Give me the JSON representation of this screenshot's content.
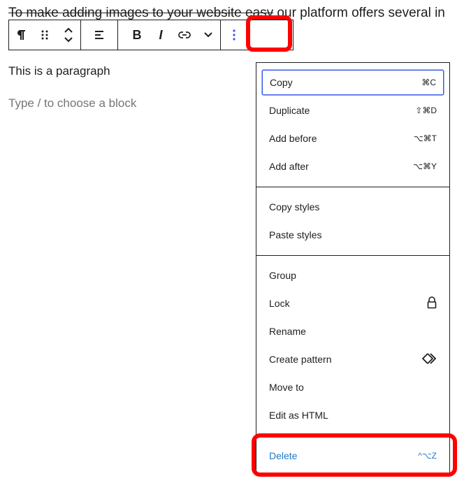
{
  "background_text": {
    "struck": "To make adding images to your website easy",
    "rest": " our platform offers several in"
  },
  "toolbar": {
    "paragraph_icon": "paragraph-icon",
    "drag_icon": "drag-handle-icon",
    "move_icon": "move-up-down-icon",
    "align_icon": "align-icon",
    "bold_label": "B",
    "italic_label": "I",
    "link_icon": "link-icon",
    "more_rich_icon": "chevron-down-icon",
    "options_icon": "vertical-ellipsis-icon"
  },
  "editor": {
    "paragraph_text": "This is a paragraph",
    "placeholder_text": "Type / to choose a block"
  },
  "menu": {
    "group1": [
      {
        "label": "Copy",
        "shortcut": "⌘C"
      },
      {
        "label": "Duplicate",
        "shortcut": "⇧⌘D"
      },
      {
        "label": "Add before",
        "shortcut": "⌥⌘T"
      },
      {
        "label": "Add after",
        "shortcut": "⌥⌘Y"
      }
    ],
    "group2": [
      {
        "label": "Copy styles"
      },
      {
        "label": "Paste styles"
      }
    ],
    "group3": [
      {
        "label": "Group"
      },
      {
        "label": "Lock",
        "icon": "lock-icon"
      },
      {
        "label": "Rename"
      },
      {
        "label": "Create pattern",
        "icon": "pattern-icon"
      },
      {
        "label": "Move to"
      },
      {
        "label": "Edit as HTML"
      }
    ],
    "delete": {
      "label": "Delete",
      "shortcut": "^⌥Z"
    }
  },
  "colors": {
    "highlight": "#ff0000",
    "focus": "#3858e9",
    "delete_text": "#1d7ac9"
  }
}
